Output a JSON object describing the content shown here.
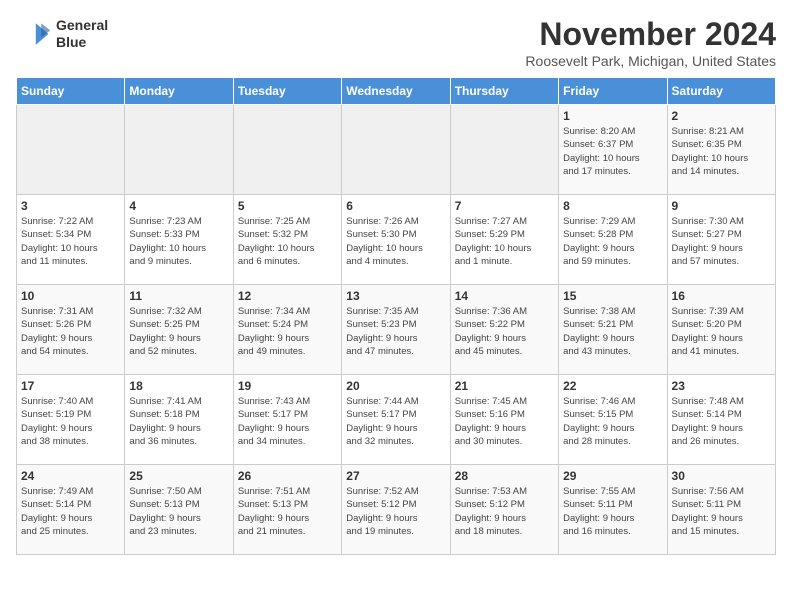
{
  "logo": {
    "line1": "General",
    "line2": "Blue"
  },
  "title": "November 2024",
  "subtitle": "Roosevelt Park, Michigan, United States",
  "headers": [
    "Sunday",
    "Monday",
    "Tuesday",
    "Wednesday",
    "Thursday",
    "Friday",
    "Saturday"
  ],
  "weeks": [
    [
      {
        "day": "",
        "info": ""
      },
      {
        "day": "",
        "info": ""
      },
      {
        "day": "",
        "info": ""
      },
      {
        "day": "",
        "info": ""
      },
      {
        "day": "",
        "info": ""
      },
      {
        "day": "1",
        "info": "Sunrise: 8:20 AM\nSunset: 6:37 PM\nDaylight: 10 hours\nand 17 minutes."
      },
      {
        "day": "2",
        "info": "Sunrise: 8:21 AM\nSunset: 6:35 PM\nDaylight: 10 hours\nand 14 minutes."
      }
    ],
    [
      {
        "day": "3",
        "info": "Sunrise: 7:22 AM\nSunset: 5:34 PM\nDaylight: 10 hours\nand 11 minutes."
      },
      {
        "day": "4",
        "info": "Sunrise: 7:23 AM\nSunset: 5:33 PM\nDaylight: 10 hours\nand 9 minutes."
      },
      {
        "day": "5",
        "info": "Sunrise: 7:25 AM\nSunset: 5:32 PM\nDaylight: 10 hours\nand 6 minutes."
      },
      {
        "day": "6",
        "info": "Sunrise: 7:26 AM\nSunset: 5:30 PM\nDaylight: 10 hours\nand 4 minutes."
      },
      {
        "day": "7",
        "info": "Sunrise: 7:27 AM\nSunset: 5:29 PM\nDaylight: 10 hours\nand 1 minute."
      },
      {
        "day": "8",
        "info": "Sunrise: 7:29 AM\nSunset: 5:28 PM\nDaylight: 9 hours\nand 59 minutes."
      },
      {
        "day": "9",
        "info": "Sunrise: 7:30 AM\nSunset: 5:27 PM\nDaylight: 9 hours\nand 57 minutes."
      }
    ],
    [
      {
        "day": "10",
        "info": "Sunrise: 7:31 AM\nSunset: 5:26 PM\nDaylight: 9 hours\nand 54 minutes."
      },
      {
        "day": "11",
        "info": "Sunrise: 7:32 AM\nSunset: 5:25 PM\nDaylight: 9 hours\nand 52 minutes."
      },
      {
        "day": "12",
        "info": "Sunrise: 7:34 AM\nSunset: 5:24 PM\nDaylight: 9 hours\nand 49 minutes."
      },
      {
        "day": "13",
        "info": "Sunrise: 7:35 AM\nSunset: 5:23 PM\nDaylight: 9 hours\nand 47 minutes."
      },
      {
        "day": "14",
        "info": "Sunrise: 7:36 AM\nSunset: 5:22 PM\nDaylight: 9 hours\nand 45 minutes."
      },
      {
        "day": "15",
        "info": "Sunrise: 7:38 AM\nSunset: 5:21 PM\nDaylight: 9 hours\nand 43 minutes."
      },
      {
        "day": "16",
        "info": "Sunrise: 7:39 AM\nSunset: 5:20 PM\nDaylight: 9 hours\nand 41 minutes."
      }
    ],
    [
      {
        "day": "17",
        "info": "Sunrise: 7:40 AM\nSunset: 5:19 PM\nDaylight: 9 hours\nand 38 minutes."
      },
      {
        "day": "18",
        "info": "Sunrise: 7:41 AM\nSunset: 5:18 PM\nDaylight: 9 hours\nand 36 minutes."
      },
      {
        "day": "19",
        "info": "Sunrise: 7:43 AM\nSunset: 5:17 PM\nDaylight: 9 hours\nand 34 minutes."
      },
      {
        "day": "20",
        "info": "Sunrise: 7:44 AM\nSunset: 5:17 PM\nDaylight: 9 hours\nand 32 minutes."
      },
      {
        "day": "21",
        "info": "Sunrise: 7:45 AM\nSunset: 5:16 PM\nDaylight: 9 hours\nand 30 minutes."
      },
      {
        "day": "22",
        "info": "Sunrise: 7:46 AM\nSunset: 5:15 PM\nDaylight: 9 hours\nand 28 minutes."
      },
      {
        "day": "23",
        "info": "Sunrise: 7:48 AM\nSunset: 5:14 PM\nDaylight: 9 hours\nand 26 minutes."
      }
    ],
    [
      {
        "day": "24",
        "info": "Sunrise: 7:49 AM\nSunset: 5:14 PM\nDaylight: 9 hours\nand 25 minutes."
      },
      {
        "day": "25",
        "info": "Sunrise: 7:50 AM\nSunset: 5:13 PM\nDaylight: 9 hours\nand 23 minutes."
      },
      {
        "day": "26",
        "info": "Sunrise: 7:51 AM\nSunset: 5:13 PM\nDaylight: 9 hours\nand 21 minutes."
      },
      {
        "day": "27",
        "info": "Sunrise: 7:52 AM\nSunset: 5:12 PM\nDaylight: 9 hours\nand 19 minutes."
      },
      {
        "day": "28",
        "info": "Sunrise: 7:53 AM\nSunset: 5:12 PM\nDaylight: 9 hours\nand 18 minutes."
      },
      {
        "day": "29",
        "info": "Sunrise: 7:55 AM\nSunset: 5:11 PM\nDaylight: 9 hours\nand 16 minutes."
      },
      {
        "day": "30",
        "info": "Sunrise: 7:56 AM\nSunset: 5:11 PM\nDaylight: 9 hours\nand 15 minutes."
      }
    ]
  ]
}
